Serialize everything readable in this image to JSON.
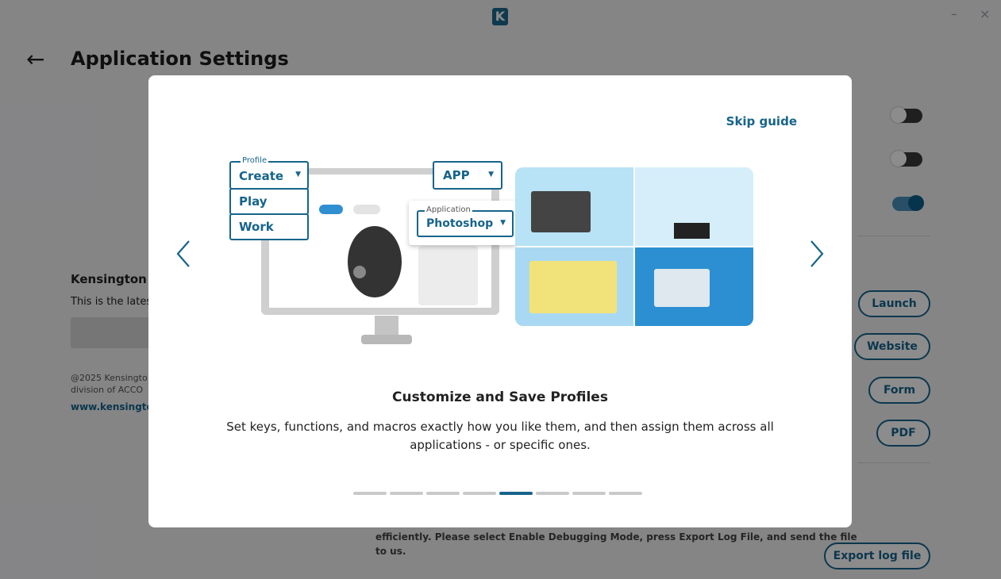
{
  "window": {
    "minimize": "–",
    "close": "×"
  },
  "header": {
    "back_icon": "arrow-left-icon",
    "title": "Application Settings"
  },
  "background": {
    "section_title": "Kensington H",
    "section_desc": "This is the lates",
    "copyright_line1": "@2025 Kensingto",
    "copyright_line2": "division of ACCO",
    "link": "www.kensington.",
    "toggles": [
      {
        "state": "off"
      },
      {
        "state": "off"
      },
      {
        "state": "on"
      }
    ],
    "buttons": {
      "launch": "Launch",
      "website": "Website",
      "form": "Form",
      "pdf": "PDF",
      "export": "Export log file"
    },
    "debug_text_line1": "efficiently. Please select Enable Debugging Mode, press Export Log File, and send the file",
    "debug_text_line2": "to us."
  },
  "modal": {
    "skip": "Skip guide",
    "title": "Customize and Save Profiles",
    "description": "Set keys, functions, and macros exactly how you like them, and then assign them across all applications - or specific ones.",
    "illustration": {
      "profile_label": "Profile",
      "profile_options": [
        "Create",
        "Play",
        "Work"
      ],
      "app_label": "APP",
      "application_label": "Application",
      "application_value": "Photoshop"
    },
    "pagination": {
      "total": 8,
      "active": 5
    }
  },
  "colors": {
    "accent": "#17648c",
    "overlay": "rgba(0,0,0,0.45)"
  }
}
